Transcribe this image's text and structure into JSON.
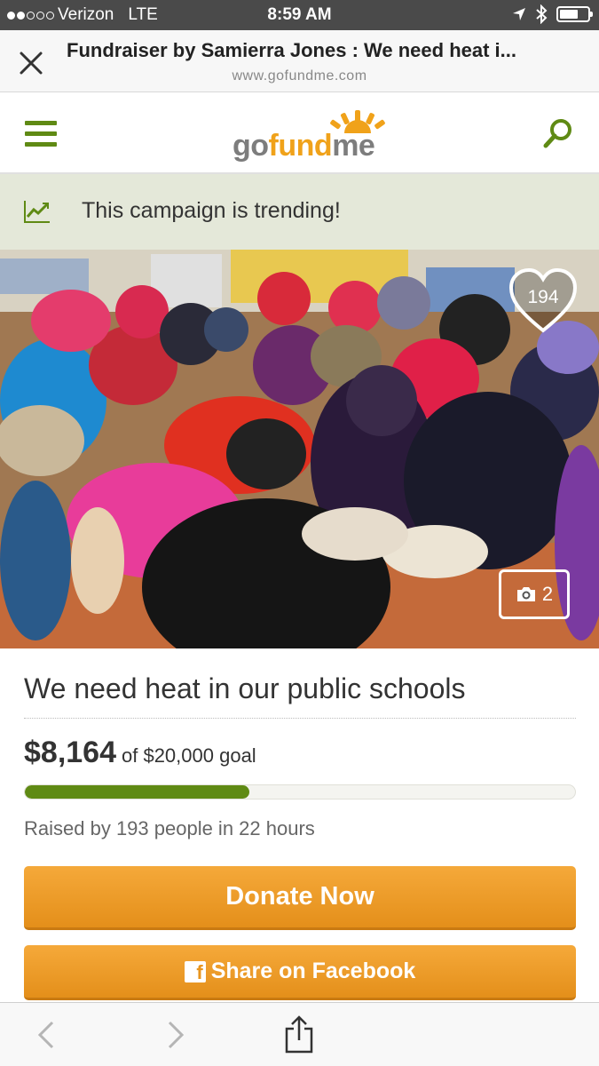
{
  "status_bar": {
    "carrier": "Verizon",
    "network": "LTE",
    "time": "8:59 AM"
  },
  "browser": {
    "page_title": "Fundraiser by Samierra Jones : We need heat i...",
    "url": "www.gofundme.com"
  },
  "site": {
    "logo_go": "go",
    "logo_fund": "fund",
    "logo_me": "me",
    "brand_green": "#5f8a14",
    "brand_orange": "#f0a21a"
  },
  "trending": {
    "text": "This campaign is trending!"
  },
  "photo": {
    "hearts": "194",
    "photo_count": "2"
  },
  "campaign": {
    "title": "We need heat in our public schools",
    "raised": "$8,164",
    "goal": "of $20,000 goal",
    "progress_fraction": 0.408,
    "raised_by": "Raised by 193 people in 22 hours"
  },
  "actions": {
    "donate_label": "Donate Now",
    "share_label": "Share on Facebook",
    "share_icon_glyph": "f"
  }
}
